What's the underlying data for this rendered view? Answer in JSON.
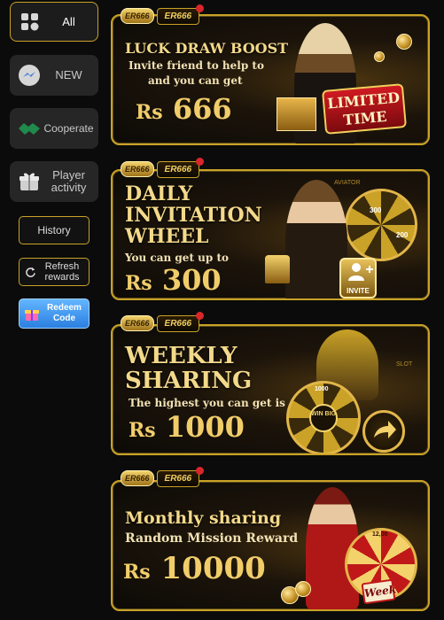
{
  "sidebar": {
    "categories": [
      {
        "label": "All",
        "icon": "grid-icon"
      },
      {
        "label": "NEW",
        "icon": "messenger-icon"
      },
      {
        "label": "Cooperate",
        "icon": "handshake-icon"
      },
      {
        "label": "Player activity",
        "icon": "gift-icon"
      }
    ],
    "history_label": "History",
    "refresh_label": "Refresh rewards",
    "redeem_label": "Redeem Code"
  },
  "banners": [
    {
      "logo_a": "ER666",
      "logo_b": "ER666",
      "title_line1": "LUCK DRAW BOOST",
      "sub1": "Invite friend to help to",
      "sub2": "and you can get",
      "currency": "Rs",
      "amount": "666",
      "badge1": "LIMITED",
      "badge2": "TIME"
    },
    {
      "logo_a": "ER666",
      "logo_b": "ER666",
      "title_line1": "DAILY",
      "title_line2": "INVITATION",
      "title_line3": "WHEEL",
      "sub1": "You can get up to",
      "currency": "Rs",
      "amount": "300",
      "badge": "INVITE",
      "wheel_value": "300",
      "wheel_value2": "200",
      "label": "AVIATOR"
    },
    {
      "logo_a": "ER666",
      "logo_b": "ER666",
      "title_line1": "WEEKLY",
      "title_line2": "SHARING",
      "sub1": "The highest you can get is",
      "currency": "Rs",
      "amount": "1000",
      "wheel_value": "1000",
      "wheel_center": "WIN BIG",
      "label": "AVIATOR",
      "label2": "SLOT"
    },
    {
      "logo_a": "ER666",
      "logo_b": "ER666",
      "title_line1": "Monthly sharing",
      "sub1": "Random Mission Reward",
      "currency": "Rs",
      "amount": "10000",
      "badge": "Week",
      "wheel_value": "12,00"
    }
  ],
  "colors": {
    "gold": "#c9a227",
    "accent_blue": "#2b7fe0",
    "badge_red": "#b0121a"
  }
}
